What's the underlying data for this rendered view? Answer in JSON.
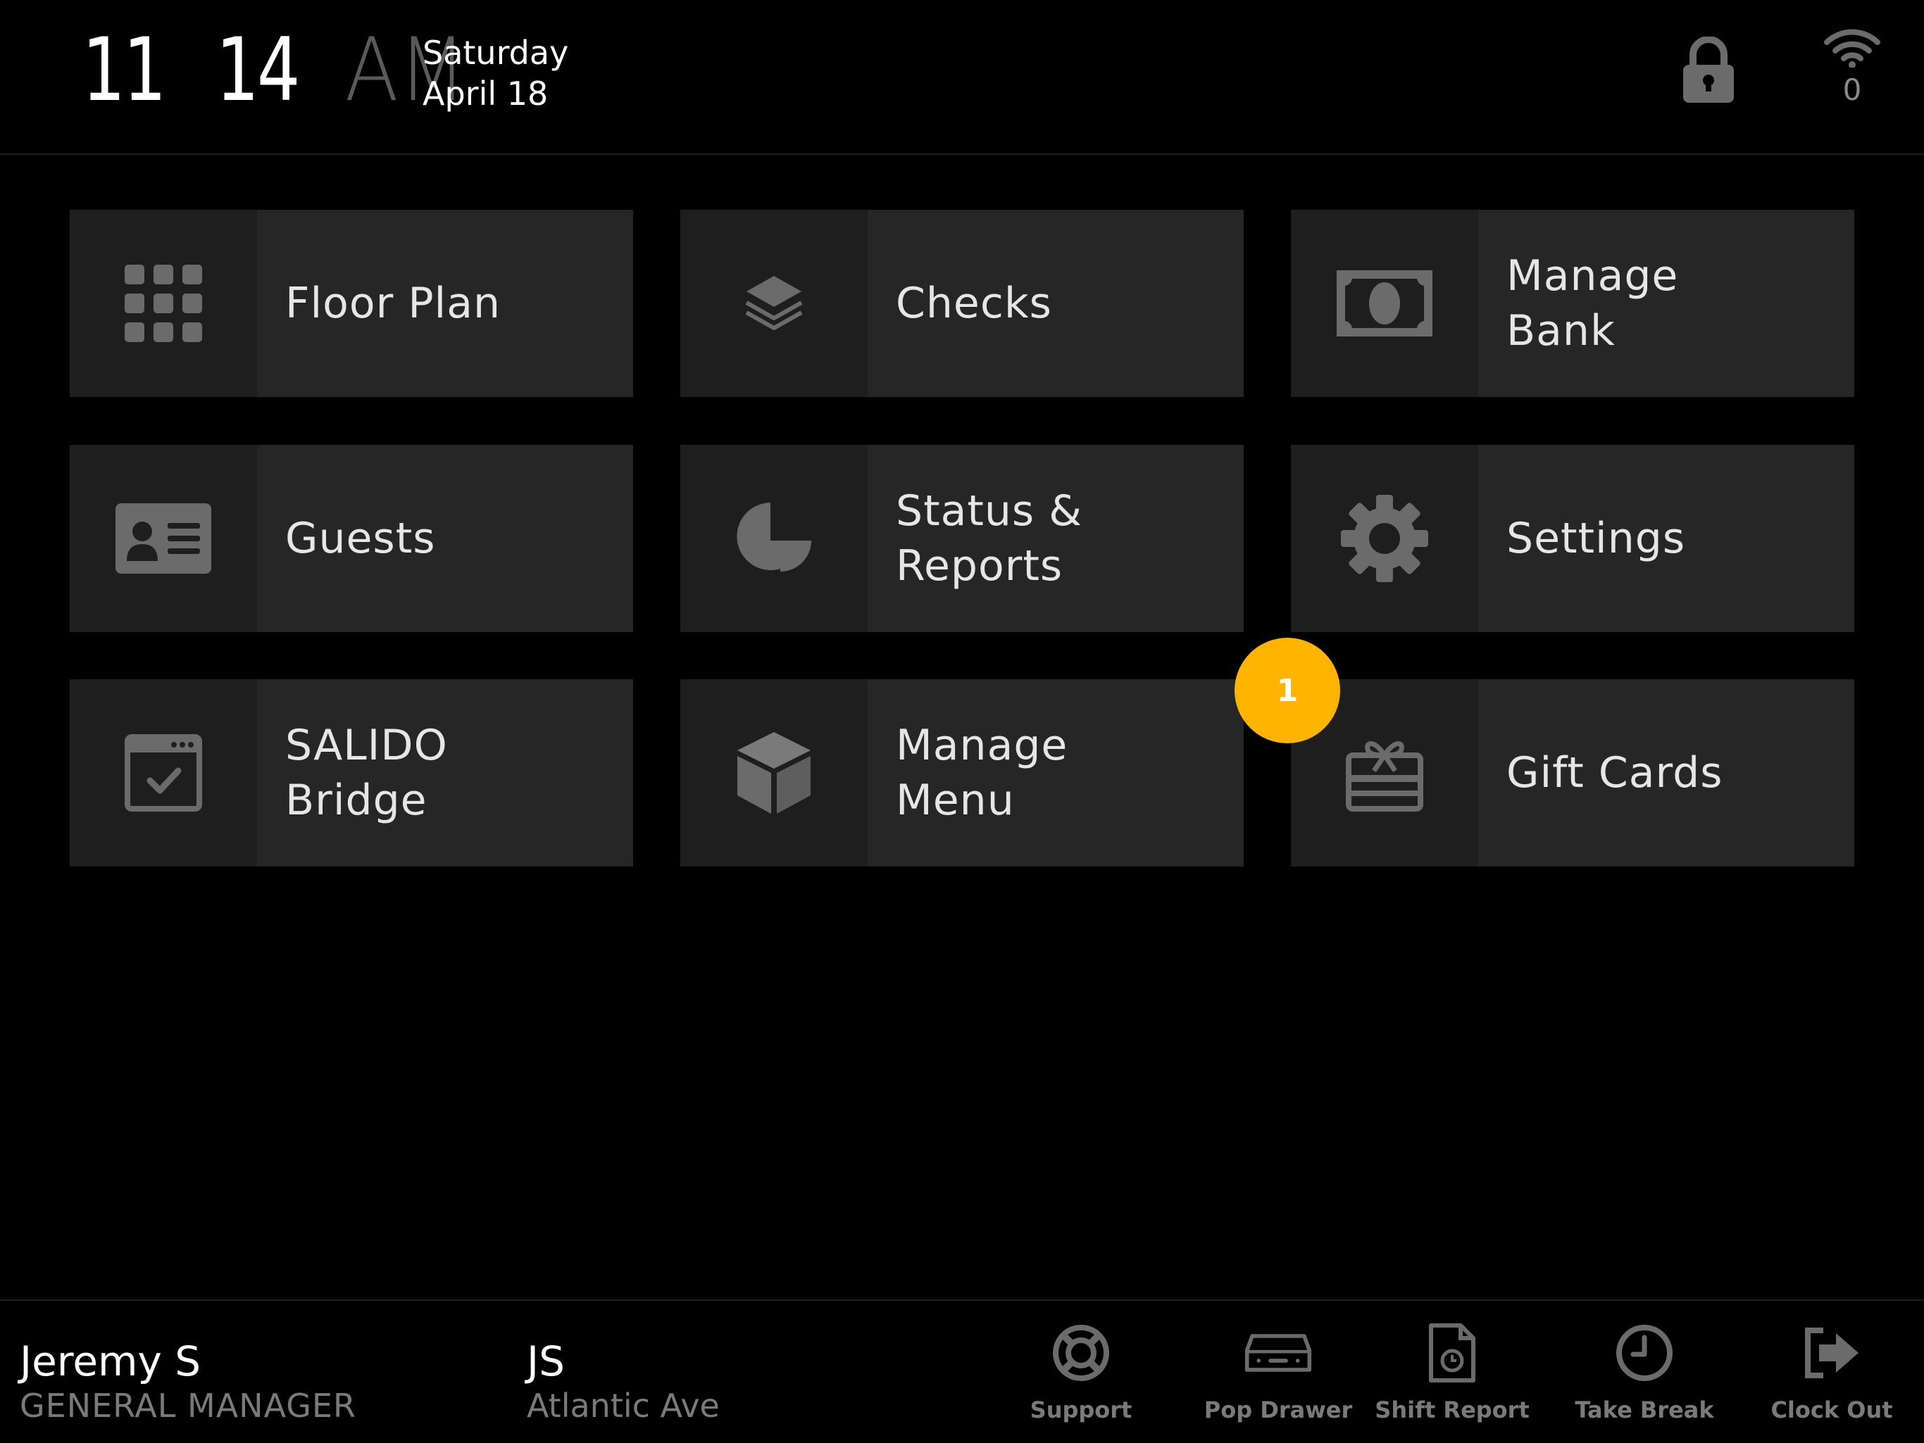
{
  "header": {
    "clock": {
      "hour": "11",
      "minute": "14",
      "ampm": "AM"
    },
    "date": {
      "weekday": "Saturday",
      "month_day": "April 18"
    },
    "network": {
      "count": "0"
    }
  },
  "tiles": [
    {
      "label": "Floor Plan",
      "icon": "grid-icon"
    },
    {
      "label": "Checks",
      "icon": "layers-icon"
    },
    {
      "label": "Manage\nBank",
      "icon": "cash-icon"
    },
    {
      "label": "Guests",
      "icon": "id-card-icon"
    },
    {
      "label": "Status &\nReports",
      "icon": "pie-chart-icon"
    },
    {
      "label": "Settings",
      "icon": "gear-icon"
    },
    {
      "label": "SALIDO\nBridge",
      "icon": "calendar-check-icon"
    },
    {
      "label": "Manage\nMenu",
      "icon": "cube-icon"
    },
    {
      "label": "Gift Cards",
      "icon": "gift-card-icon"
    }
  ],
  "badge": {
    "value": "1"
  },
  "footer": {
    "user": {
      "name": "Jeremy S",
      "role": "GENERAL MANAGER"
    },
    "location": {
      "initials": "JS",
      "name": "Atlantic Ave"
    },
    "actions": [
      {
        "label": "Support",
        "icon": "lifebuoy-icon"
      },
      {
        "label": "Pop Drawer",
        "icon": "cash-drawer-icon"
      },
      {
        "label": "Shift Report",
        "icon": "shift-report-icon"
      },
      {
        "label": "Take Break",
        "icon": "clock-icon"
      },
      {
        "label": "Clock Out",
        "icon": "sign-out-icon"
      }
    ]
  },
  "colors": {
    "background": "#000000",
    "tile": "#262626",
    "tile_icon_bg": "#1e1e1e",
    "icon": "#6b6b6b",
    "badge": "#ffb400",
    "muted_text": "#7a7a7a"
  }
}
